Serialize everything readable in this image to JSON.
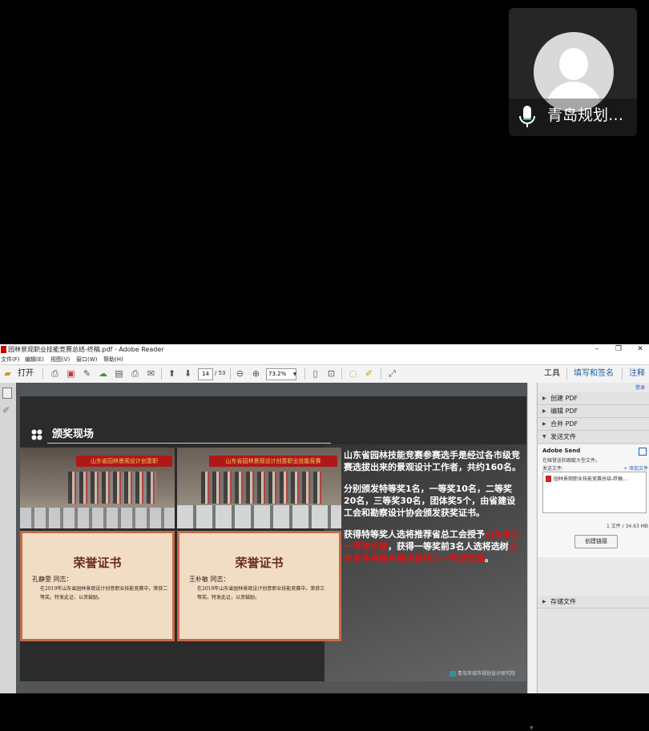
{
  "call_tile": {
    "participant_name": "青岛规划…"
  },
  "window": {
    "title": "园林景观职业技能竞赛总结-终稿.pdf - Adobe Reader",
    "controls": {
      "minimize": "–",
      "restore": "❐",
      "close": "✕"
    }
  },
  "menubar": {
    "items": [
      "文件(F)",
      "编辑(E)",
      "视图(V)",
      "窗口(W)",
      "帮助(H)"
    ]
  },
  "toolbar": {
    "open_label": "打开",
    "page_current": "14",
    "page_total": "/ 53",
    "zoom": "73.2%",
    "right_links": [
      "工具",
      "填写和签名",
      "注释"
    ]
  },
  "slide": {
    "section_title": "颁奖现场",
    "banner_text_1": "山东省园林景观设计创意职",
    "banner_text_2": "山东省园林景观设计创意职业技能竞赛",
    "cert_title": "荣誉证书",
    "cert1_name": "孔静雯 同志：",
    "cert1_body": "在2019年山东省园林景观设计创意职业技能竞赛中，荣获二等奖。特发此证，以资鼓励。",
    "cert2_name": "王朴敏 同志：",
    "cert2_body": "在2019年山东省园林景观设计创意职业技能竞赛中，荣获三等奖。特发此证，以资鼓励。",
    "para1": "山东省园林技能竞赛参赛选手是经过各市级竞赛选拔出来的景观设计工作者，共约160名。",
    "para2": "分别颁发特等奖1名，一等奖10名，二等奖20名，三等奖30名，团体奖5个，由省建设工会和勘察设计协会颁发获奖证书。",
    "para3_a": "获得特等奖人选将推荐省总工会授予",
    "para3_red1": "山东省五一劳动奖章",
    "para3_b": "，获得一等奖前3名人选将选树",
    "para3_red2": "山东省住房城乡建设系统五一劳动奖章",
    "para3_c": "。",
    "logo_text": "青岛市城市规划设计研究院"
  },
  "right_pane": {
    "top_link": "登录",
    "panels": [
      "创建 PDF",
      "编辑 PDF",
      "合并 PDF",
      "发送文件"
    ],
    "send_title": "Adobe Send",
    "send_desc": "在線發送和跟蹤大型文件。",
    "send_sub": "发送文件:",
    "add_file": "+ 添加文件",
    "file_name": "园林景观职业技能竞赛总结-终稿...",
    "file_count": "1 文件 / 34.63 MB",
    "create_link": "创建链接",
    "storage_panel": "存储文件"
  }
}
